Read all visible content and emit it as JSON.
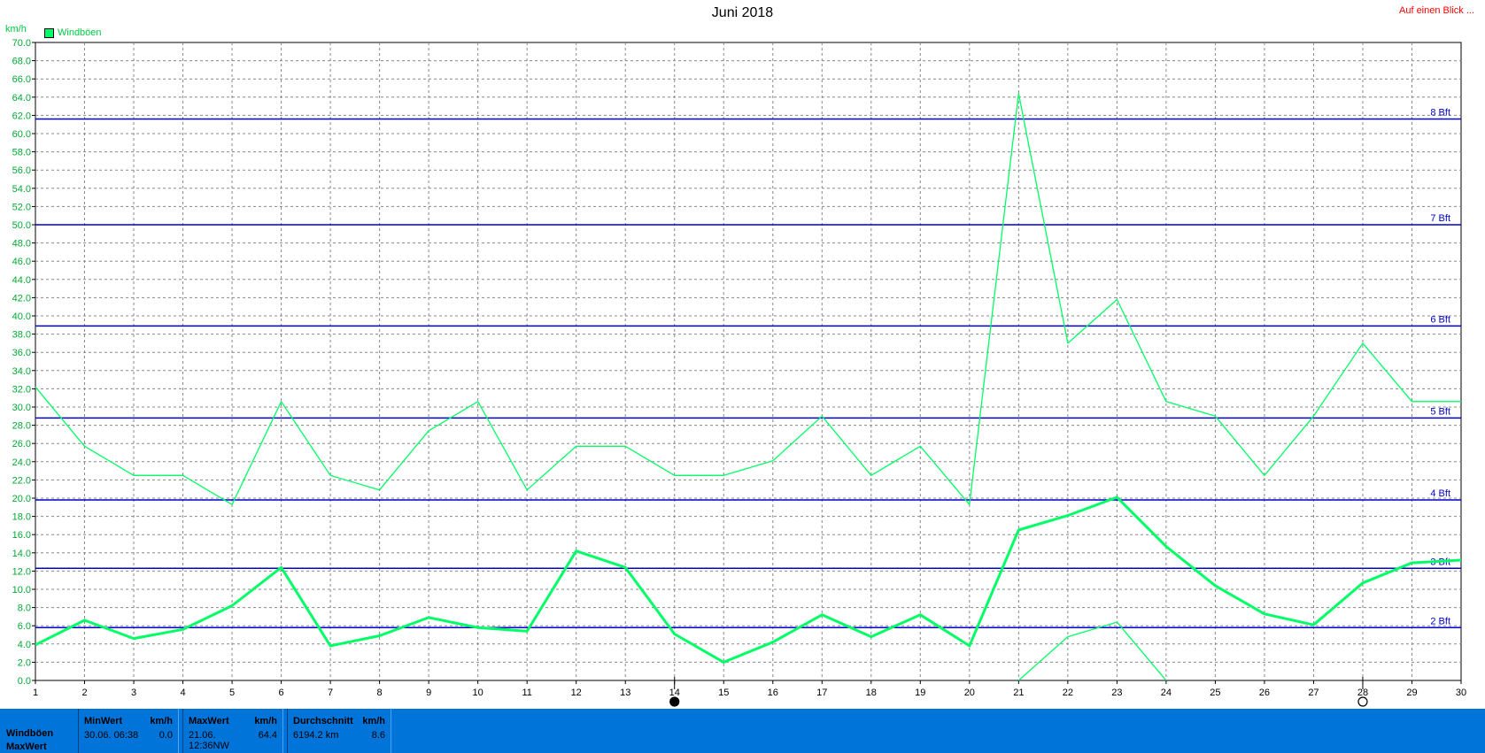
{
  "page": {
    "title": "Juni 2018",
    "overview_link": "Auf einen Blick ...",
    "unit_label": "km/h",
    "legend_label": "Windböen"
  },
  "colors": {
    "series": "#00ff66",
    "beaufort_lines": "#0000cc",
    "stats_bar": "#0074d9",
    "link": "#ff0000"
  },
  "chart_data": {
    "type": "line",
    "title": "Juni 2018",
    "ylabel": "km/h",
    "ylim": [
      0,
      70
    ],
    "ytick_step": 2,
    "xlim": [
      1,
      30
    ],
    "x": [
      1,
      2,
      3,
      4,
      5,
      6,
      7,
      8,
      9,
      10,
      11,
      12,
      13,
      14,
      15,
      16,
      17,
      18,
      19,
      20,
      21,
      22,
      23,
      24,
      25,
      26,
      27,
      28,
      29,
      30
    ],
    "series": [
      {
        "name": "Windböen",
        "role": "max",
        "values": [
          32.2,
          25.7,
          22.5,
          22.5,
          19.3,
          30.6,
          22.5,
          20.9,
          27.4,
          30.6,
          20.9,
          25.7,
          25.7,
          22.5,
          22.5,
          24.1,
          29.0,
          22.5,
          25.7,
          19.3,
          64.4,
          37.0,
          41.8,
          30.6,
          29.0,
          22.5,
          29.0,
          37.0,
          30.6,
          30.6
        ]
      },
      {
        "role": "average",
        "values": [
          3.9,
          6.6,
          4.6,
          5.6,
          8.2,
          12.4,
          3.8,
          4.9,
          6.9,
          5.8,
          5.4,
          14.2,
          12.4,
          5.1,
          2.0,
          4.2,
          7.2,
          4.8,
          7.2,
          3.8,
          16.5,
          18.1,
          20.1,
          14.7,
          10.4,
          7.3,
          6.1,
          10.7,
          12.9,
          13.2
        ]
      },
      {
        "role": "min",
        "points": [
          [
            21,
            0.0
          ],
          [
            22,
            4.8
          ],
          [
            23,
            6.4
          ],
          [
            24,
            0.0
          ]
        ]
      }
    ],
    "reference_lines": [
      {
        "label": "2 Bft",
        "value": 5.8
      },
      {
        "label": "3 Bft",
        "value": 12.3
      },
      {
        "label": "4 Bft",
        "value": 19.8
      },
      {
        "label": "5 Bft",
        "value": 28.8
      },
      {
        "label": "6 Bft",
        "value": 38.9
      },
      {
        "label": "7 Bft",
        "value": 50.0
      },
      {
        "label": "8 Bft",
        "value": 61.6
      }
    ],
    "moon_markers": [
      {
        "x": 14,
        "phase": "new"
      },
      {
        "x": 28,
        "phase": "full"
      }
    ]
  },
  "stats": {
    "row_label_1": "Windböen",
    "row_label_2": "MaxWert",
    "min": {
      "header": "MinWert",
      "unit": "km/h",
      "when": "30.06.  06:38",
      "value": "0.0"
    },
    "max": {
      "header": "MaxWert",
      "unit": "km/h",
      "when": "21.06.  12:36NW",
      "value": "64.4"
    },
    "avg": {
      "header": "Durchschnitt",
      "unit": "km/h",
      "when": "6194.2 km",
      "value": "8.6"
    }
  }
}
